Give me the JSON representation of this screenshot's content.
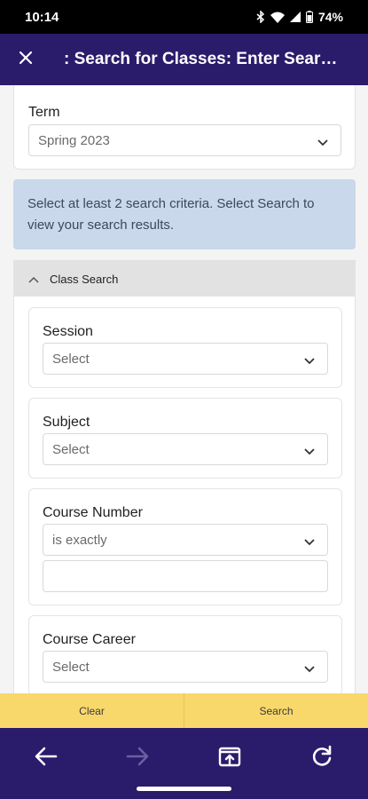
{
  "status": {
    "time": "10:14",
    "battery": "74%"
  },
  "header": {
    "title": ": Search for Classes: Enter Search..."
  },
  "term": {
    "label": "Term",
    "value": "Spring 2023"
  },
  "info": {
    "message": "Select at least 2 search criteria. Select Search to view your search results."
  },
  "class_search": {
    "title": "Class Search",
    "fields": {
      "session": {
        "label": "Session",
        "value": "Select"
      },
      "subject": {
        "label": "Subject",
        "value": "Select"
      },
      "course_number": {
        "label": "Course Number",
        "operator": "is exactly",
        "value": ""
      },
      "course_career": {
        "label": "Course Career",
        "value": "Select"
      }
    }
  },
  "actions": {
    "clear_label": "Clear",
    "search_label": "Search"
  },
  "nav": {
    "back_icon": "arrow-left-icon",
    "forward_icon": "arrow-right-icon",
    "share_icon": "open-external-icon",
    "refresh_icon": "refresh-icon"
  },
  "colors": {
    "header_bg": "#2b1b6b",
    "info_bg": "#c9d8ea",
    "button_bar_bg": "#f9d86b"
  }
}
